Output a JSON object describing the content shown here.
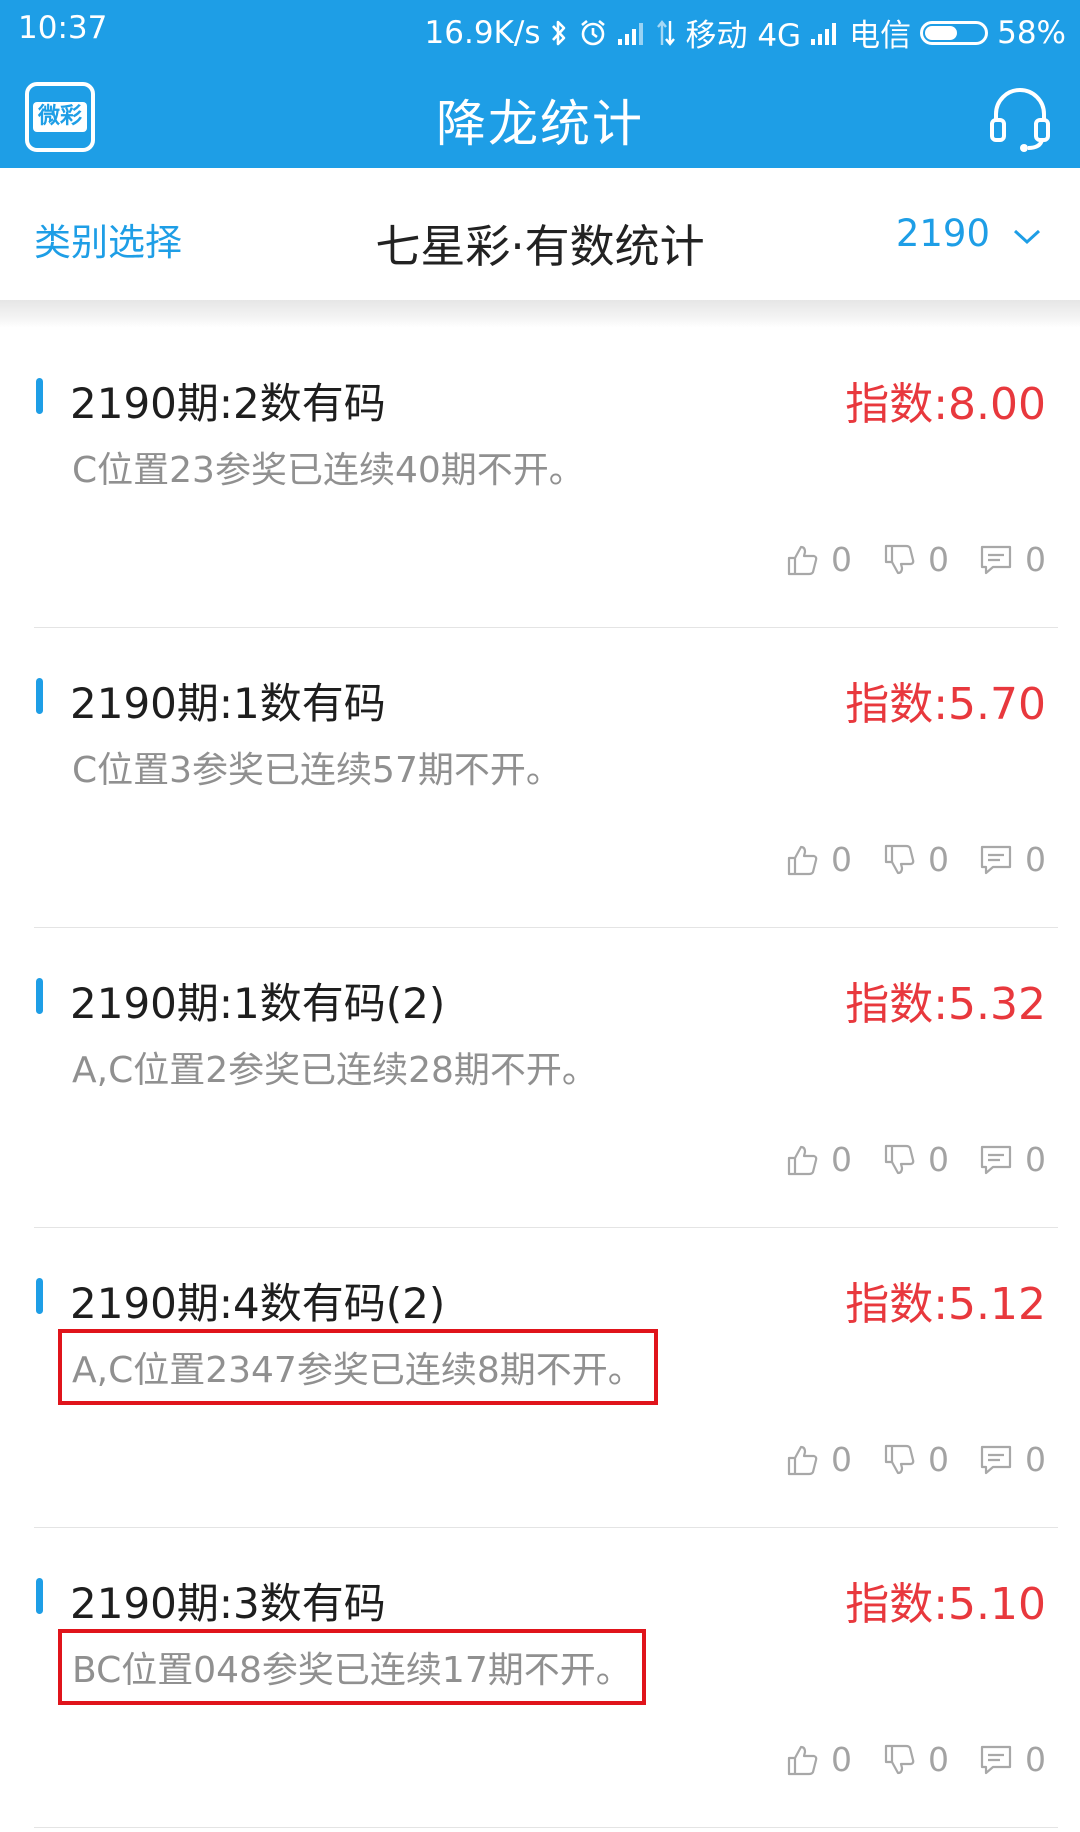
{
  "status_bar": {
    "time": "10:37",
    "net_speed": "16.9K/s",
    "carrier1": "移动 4G",
    "carrier2": "电信",
    "battery_percent": "58%",
    "battery_level": 0.58,
    "icons": [
      "bluetooth-icon",
      "alarm-icon",
      "signal-icon",
      "data-transfer-icon",
      "signal-icon",
      "battery-icon"
    ]
  },
  "header": {
    "logo_text": "微彩",
    "title": "降龙统计",
    "right_icon": "headset-support-icon"
  },
  "category_bar": {
    "select_label": "类别选择",
    "title": "七星彩·有数统计",
    "issue": "2190",
    "issue_icon": "chevron-down-icon"
  },
  "colors": {
    "brand_blue": "#1e9ee6",
    "index_red": "#e8383d",
    "highlight_red": "#e0141b"
  },
  "cards": [
    {
      "title": "2190期:2数有码",
      "index": "指数:8.00",
      "desc": "C位置23参奖已连续40期不开。",
      "highlighted": false,
      "likes": "0",
      "dislikes": "0",
      "comments": "0"
    },
    {
      "title": "2190期:1数有码",
      "index": "指数:5.70",
      "desc": "C位置3参奖已连续57期不开。",
      "highlighted": false,
      "likes": "0",
      "dislikes": "0",
      "comments": "0"
    },
    {
      "title": "2190期:1数有码(2)",
      "index": "指数:5.32",
      "desc": "A,C位置2参奖已连续28期不开。",
      "highlighted": false,
      "likes": "0",
      "dislikes": "0",
      "comments": "0"
    },
    {
      "title": "2190期:4数有码(2)",
      "index": "指数:5.12",
      "desc": "A,C位置2347参奖已连续8期不开。",
      "highlighted": true,
      "likes": "0",
      "dislikes": "0",
      "comments": "0"
    },
    {
      "title": "2190期:3数有码",
      "index": "指数:5.10",
      "desc": "BC位置048参奖已连续17期不开。",
      "highlighted": true,
      "likes": "0",
      "dislikes": "0",
      "comments": "0"
    }
  ]
}
